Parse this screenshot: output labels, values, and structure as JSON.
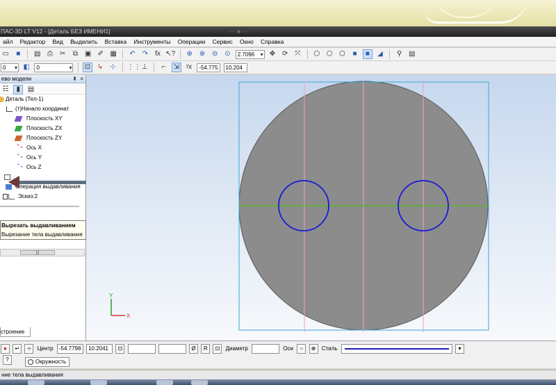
{
  "window": {
    "title": "ПАС-3D LT V12 - [Деталь БЕЗ ИМЕНИ1]"
  },
  "menu": [
    "айл",
    "Редактор",
    "Вид",
    "Выделить",
    "Вставка",
    "Инструменты",
    "Операции",
    "Сервис",
    "Окно",
    "Справка"
  ],
  "toolbar": {
    "zoom_value": "2.7096",
    "style_value": "0",
    "layer_value": "0",
    "coord_x": "-54.775",
    "coord_y": "10.204"
  },
  "tree": {
    "header": "ево модели",
    "items": [
      {
        "label": "Деталь (Тел-1)",
        "icon": "part-icon"
      },
      {
        "label": "(т)Начало координат",
        "icon": "origin-icon"
      },
      {
        "label": "Плоскость XY",
        "icon": "plane-xy-icon"
      },
      {
        "label": "Плоскость ZX",
        "icon": "plane-zx-icon"
      },
      {
        "label": "Плоскость ZY",
        "icon": "plane-zy-icon"
      },
      {
        "label": "Ось X",
        "icon": "axis-x-icon"
      },
      {
        "label": "Ось Y",
        "icon": "axis-y-icon"
      },
      {
        "label": "Ось Z",
        "icon": "axis-z-icon"
      },
      {
        "label": "Операция выдавливания",
        "icon": "extrude-icon"
      },
      {
        "label": "Эскиз:2",
        "icon": "sketch-icon"
      }
    ],
    "tooltip_title": "Вырезать выдавливанием",
    "tooltip_desc": "Вырезание тела выдавливания",
    "bottom_tab": "строение"
  },
  "properties": {
    "center_label": "Центр",
    "center_x": "-54.7798",
    "center_y": "10.2041",
    "diameter_label": "Диаметр",
    "axes_label": "Оси",
    "style_label": "Стиль",
    "tab_label": "Окружность"
  },
  "status": {
    "text": "ние тела выдавливания"
  },
  "colors": {
    "body_gray": "#8c8c8c",
    "circle_blue": "#1a1ad6",
    "axis_green": "#5fb32a",
    "frame_cyan": "#39a7d6",
    "guide_pink": "#e7a3c4"
  },
  "viewport": {
    "axis_x_label": "X",
    "axis_y_label": "Y"
  }
}
